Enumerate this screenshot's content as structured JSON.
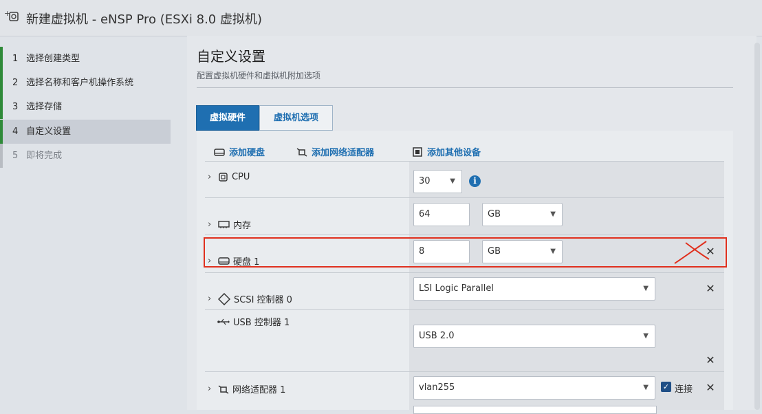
{
  "window": {
    "title": "新建虚拟机 - eNSP Pro (ESXi 8.0 虚拟机)",
    "icon": "new-vm-icon"
  },
  "steps": [
    {
      "num": "1",
      "label": "选择创建类型",
      "state": "done"
    },
    {
      "num": "2",
      "label": "选择名称和客户机操作系统",
      "state": "done"
    },
    {
      "num": "3",
      "label": "选择存储",
      "state": "done"
    },
    {
      "num": "4",
      "label": "自定义设置",
      "state": "active"
    },
    {
      "num": "5",
      "label": "即将完成",
      "state": "future"
    }
  ],
  "page": {
    "title": "自定义设置",
    "subtitle": "配置虚拟机硬件和虚拟机附加选项"
  },
  "tabs": [
    {
      "label": "虚拟硬件",
      "selected": true
    },
    {
      "label": "虚拟机选项",
      "selected": false
    }
  ],
  "actions": {
    "add_disk": "添加硬盘",
    "add_nic": "添加网络适配器",
    "add_other": "添加其他设备"
  },
  "hardware": {
    "cpu": {
      "label": "CPU",
      "value": "30"
    },
    "memory": {
      "label": "内存",
      "value": "64",
      "unit": "GB"
    },
    "disk": {
      "label": "硬盘 1",
      "value": "8",
      "unit": "GB"
    },
    "scsi": {
      "label": "SCSI 控制器 0",
      "value": "LSI Logic Parallel"
    },
    "usb": {
      "label": "USB 控制器 1",
      "value": "USB 2.0"
    },
    "nic": {
      "label": "网络适配器 1",
      "value": "vlan255",
      "connect_label": "连接",
      "connected": true
    }
  },
  "annotation": {
    "highlight_color": "#e0301e"
  },
  "colors": {
    "accent": "#1f6fb1",
    "step_done": "#2f8a39"
  }
}
